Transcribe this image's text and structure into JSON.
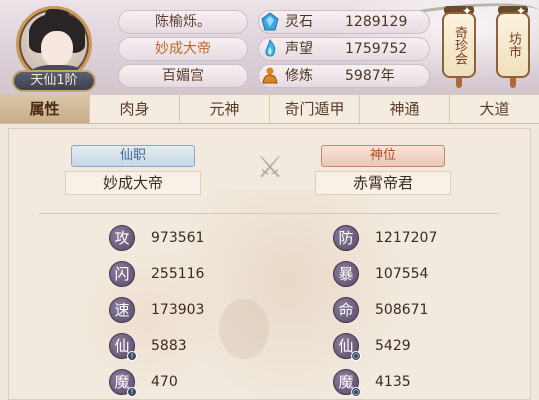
{
  "profile": {
    "rank": "天仙1阶",
    "name": "陈榆烁。",
    "title": "妙成大帝",
    "sect": "百媚宫"
  },
  "resources": [
    {
      "name": "灵石",
      "value": "1289129",
      "icon": "spirit-stone-icon",
      "color": "#3aa6e6"
    },
    {
      "name": "声望",
      "value": "1759752",
      "icon": "reputation-flame-icon",
      "color": "#3fb7e8"
    },
    {
      "name": "修炼",
      "value": "5987年",
      "icon": "meditation-icon",
      "color": "#d9861d"
    }
  ],
  "side_buttons": [
    {
      "label": "奇珍会"
    },
    {
      "label": "坊市"
    }
  ],
  "tabs": [
    {
      "label": "属性",
      "active": true
    },
    {
      "label": "肉身",
      "active": false
    },
    {
      "label": "元神",
      "active": false
    },
    {
      "label": "奇门遁甲",
      "active": false
    },
    {
      "label": "神通",
      "active": false
    },
    {
      "label": "大道",
      "active": false
    }
  ],
  "roles": {
    "left": {
      "label": "仙职",
      "value": "妙成大帝"
    },
    "right": {
      "label": "神位",
      "value": "赤霄帝君"
    }
  },
  "stats_left": [
    {
      "badge": "攻",
      "value": "973561",
      "mark": false
    },
    {
      "badge": "闪",
      "value": "255116",
      "mark": false
    },
    {
      "badge": "速",
      "value": "173903",
      "mark": false
    },
    {
      "badge": "仙",
      "value": "5883",
      "mark": true
    },
    {
      "badge": "魔",
      "value": "470",
      "mark": true
    }
  ],
  "stats_right": [
    {
      "badge": "防",
      "value": "1217207",
      "mark": false
    },
    {
      "badge": "暴",
      "value": "107554",
      "mark": false
    },
    {
      "badge": "命",
      "value": "508671",
      "mark": false
    },
    {
      "badge": "仙",
      "value": "5429",
      "mark": true
    },
    {
      "badge": "魔",
      "value": "4135",
      "mark": true
    }
  ]
}
